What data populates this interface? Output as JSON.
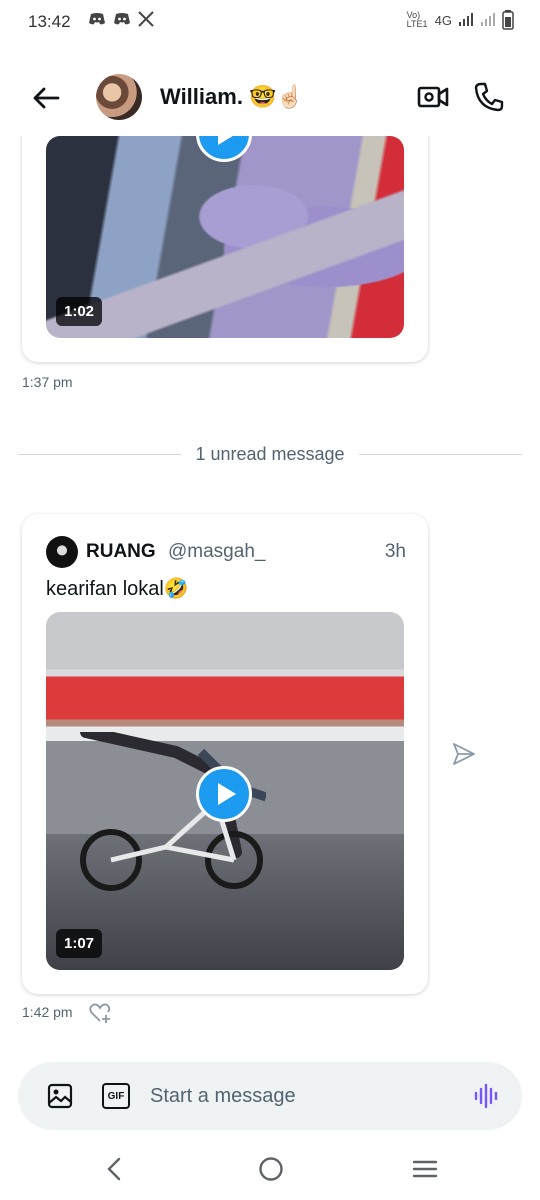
{
  "status_bar": {
    "time": "13:42",
    "left_icons": [
      "discord-icon",
      "discord-icon",
      "x-icon"
    ],
    "volte": "Vo) LTE1",
    "network": "4G",
    "right_icons": [
      "signal-icon",
      "signal-icon",
      "battery-icon"
    ]
  },
  "header": {
    "contact_name": "William. 🤓☝🏻",
    "back_icon": "arrow-left-icon",
    "video_icon": "video-camera-icon",
    "call_icon": "phone-icon"
  },
  "messages": [
    {
      "type": "video",
      "duration": "1:02",
      "timestamp": "1:37 pm"
    },
    {
      "type": "shared-post",
      "author_name": "RUANG",
      "author_handle": "@masgah_",
      "post_age": "3h",
      "text": "kearifan lokal🤣",
      "video_duration": "1:07",
      "timestamp": "1:42 pm"
    }
  ],
  "unread_divider": "1 unread message",
  "composer": {
    "placeholder": "Start a message",
    "gif_label": "GIF"
  },
  "colors": {
    "accent": "#1d9bf0",
    "voice": "#7856ff",
    "muted_text": "#536471"
  }
}
